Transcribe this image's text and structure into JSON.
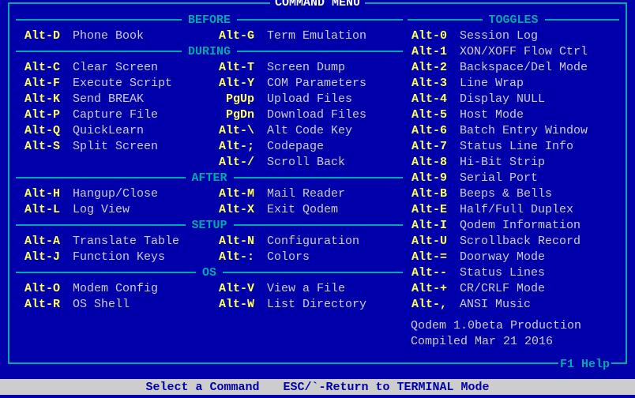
{
  "title": "COMMAND MENU",
  "f1": "F1 Help",
  "status": {
    "a": "Select a Command",
    "b": "ESC/`-Return to TERMINAL Mode"
  },
  "version": {
    "a": "Qodem 1.0beta Production",
    "b": "Compiled Mar 21 2016"
  },
  "sections": {
    "before": {
      "label": "BEFORE",
      "left": [
        {
          "k": "Alt-D",
          "d": "Phone Book"
        }
      ],
      "right": [
        {
          "k": "Alt-G",
          "d": "Term Emulation"
        }
      ]
    },
    "during": {
      "label": "DURING",
      "left": [
        {
          "k": "Alt-C",
          "d": "Clear Screen"
        },
        {
          "k": "Alt-F",
          "d": "Execute Script"
        },
        {
          "k": "Alt-K",
          "d": "Send BREAK"
        },
        {
          "k": "Alt-P",
          "d": "Capture File"
        },
        {
          "k": "Alt-Q",
          "d": "QuickLearn"
        },
        {
          "k": "Alt-S",
          "d": "Split Screen"
        }
      ],
      "right": [
        {
          "k": "Alt-T",
          "d": "Screen Dump"
        },
        {
          "k": "Alt-Y",
          "d": "COM Parameters"
        },
        {
          "k": "PgUp",
          "d": "Upload Files"
        },
        {
          "k": "PgDn",
          "d": "Download Files"
        },
        {
          "k": "Alt-\\",
          "d": "Alt Code Key"
        },
        {
          "k": "Alt-;",
          "d": "Codepage"
        },
        {
          "k": "Alt-/",
          "d": "Scroll Back"
        }
      ]
    },
    "after": {
      "label": "AFTER",
      "left": [
        {
          "k": "Alt-H",
          "d": "Hangup/Close"
        },
        {
          "k": "Alt-L",
          "d": "Log View"
        }
      ],
      "right": [
        {
          "k": "Alt-M",
          "d": "Mail Reader"
        },
        {
          "k": "Alt-X",
          "d": "Exit Qodem"
        }
      ]
    },
    "setup": {
      "label": "SETUP",
      "left": [
        {
          "k": "Alt-A",
          "d": "Translate Table"
        },
        {
          "k": "Alt-J",
          "d": "Function Keys"
        }
      ],
      "right": [
        {
          "k": "Alt-N",
          "d": "Configuration"
        },
        {
          "k": "Alt-:",
          "d": "Colors"
        }
      ]
    },
    "os": {
      "label": "OS",
      "left": [
        {
          "k": "Alt-O",
          "d": "Modem Config"
        },
        {
          "k": "Alt-R",
          "d": "OS Shell"
        }
      ],
      "right": [
        {
          "k": "Alt-V",
          "d": "View a File"
        },
        {
          "k": "Alt-W",
          "d": "List Directory"
        }
      ]
    }
  },
  "toggles": {
    "label": "TOGGLES",
    "items": [
      {
        "k": "Alt-0",
        "d": "Session Log"
      },
      {
        "k": "Alt-1",
        "d": "XON/XOFF Flow Ctrl"
      },
      {
        "k": "Alt-2",
        "d": "Backspace/Del Mode"
      },
      {
        "k": "Alt-3",
        "d": "Line Wrap"
      },
      {
        "k": "Alt-4",
        "d": "Display NULL"
      },
      {
        "k": "Alt-5",
        "d": "Host Mode"
      },
      {
        "k": "Alt-6",
        "d": "Batch Entry Window"
      },
      {
        "k": "Alt-7",
        "d": "Status Line Info"
      },
      {
        "k": "Alt-8",
        "d": "Hi-Bit Strip"
      },
      {
        "k": "Alt-9",
        "d": "Serial Port"
      },
      {
        "k": "Alt-B",
        "d": "Beeps & Bells"
      },
      {
        "k": "Alt-E",
        "d": "Half/Full Duplex"
      },
      {
        "k": "Alt-I",
        "d": "Qodem Information"
      },
      {
        "k": "Alt-U",
        "d": "Scrollback Record"
      },
      {
        "k": "Alt-=",
        "d": "Doorway Mode"
      },
      {
        "k": "Alt--",
        "d": "Status Lines"
      },
      {
        "k": "Alt-+",
        "d": "CR/CRLF Mode"
      },
      {
        "k": "Alt-,",
        "d": "ANSI Music"
      }
    ]
  }
}
